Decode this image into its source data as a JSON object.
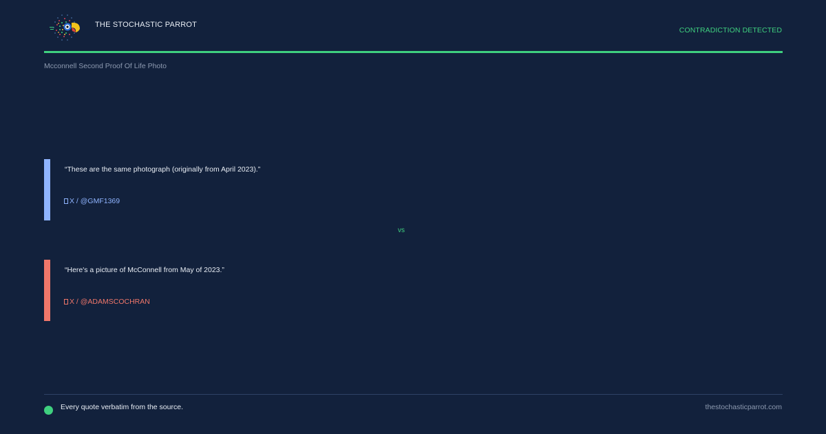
{
  "header": {
    "brand": "THE STOCHASTIC PARROT",
    "status": "CONTRADICTION DETECTED",
    "subtitle": "Mcconnell Second Proof Of Life Photo"
  },
  "quotes": [
    {
      "text": "“These are the same photograph (originally from April 2023).”",
      "source": "X / @GMF1369",
      "color": "#8fb4ff"
    },
    {
      "text": "“Here's a picture of McConnell from May of 2023.”",
      "source": "X / @ADAMSCOCHRAN",
      "color": "#f0776a"
    }
  ],
  "separator": "vs",
  "footer": {
    "note": "Every quote verbatim from the source.",
    "site": "thestochasticparrot.com"
  },
  "colors": {
    "background": "#12213c",
    "accent": "#3fd07f"
  },
  "icons": {
    "logo": "parrot-logo-icon",
    "source": "x-platform-icon",
    "footer": "status-dot-icon"
  }
}
